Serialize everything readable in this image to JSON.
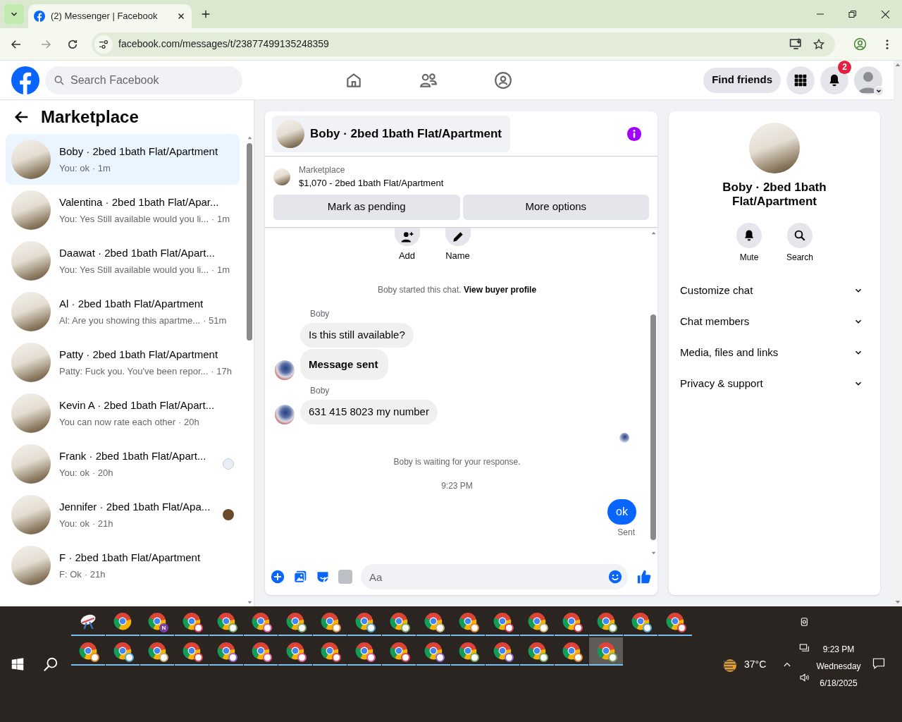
{
  "browser": {
    "tab_title": "(2) Messenger | Facebook",
    "url": "facebook.com/messages/t/23877499135248359"
  },
  "header": {
    "search_placeholder": "Search Facebook",
    "find_friends": "Find friends",
    "notification_count": "2"
  },
  "sidebar": {
    "title": "Marketplace",
    "conversations": [
      {
        "name": "Boby · 2bed 1bath Flat/Apartment",
        "preview": "You: ok",
        "time": "· 1m",
        "selected": true,
        "kind": "plain"
      },
      {
        "name": "Valentina · 2bed 1bath Flat/Apar...",
        "preview": "You: Yes Still available would you li...",
        "time": "· 1m",
        "selected": false,
        "kind": "plain"
      },
      {
        "name": "Daawat · 2bed 1bath Flat/Apart...",
        "preview": "You: Yes Still available would you li...",
        "time": "· 1m",
        "selected": false,
        "kind": "plain"
      },
      {
        "name": "Al · 2bed 1bath Flat/Apartment",
        "preview": "Al: Are you showing this apartme...",
        "time": "· 51m",
        "selected": false,
        "kind": "plain"
      },
      {
        "name": "Patty · 2bed 1bath Flat/Apartment",
        "preview": "Patty: Fuck you. You've been repor...",
        "time": "· 17h",
        "selected": false,
        "kind": "plain"
      },
      {
        "name": "Kevin A · 2bed 1bath Flat/Apart...",
        "preview": "You can now rate each other",
        "time": "· 20h",
        "selected": false,
        "kind": "plain"
      },
      {
        "name": "Frank · 2bed 1bath Flat/Apart...",
        "preview": "You: ok",
        "time": "· 20h",
        "selected": false,
        "kind": "seen-icon"
      },
      {
        "name": "Jennifer · 2bed 1bath Flat/Apa...",
        "preview": "You: ok",
        "time": "· 21h",
        "selected": false,
        "kind": "seen-photo"
      },
      {
        "name": "F · 2bed 1bath Flat/Apartment",
        "preview": "F: Ok",
        "time": "· 21h",
        "selected": false,
        "kind": "plain"
      }
    ]
  },
  "chat": {
    "title": "Boby · 2bed 1bath Flat/Apartment",
    "listing_label": "Marketplace",
    "listing": "$1,070 - 2bed 1bath Flat/Apartment",
    "buttons": [
      "Mark as pending",
      "More options"
    ],
    "actions": [
      {
        "kind": "add",
        "label": "Add"
      },
      {
        "kind": "name",
        "label": "Name"
      }
    ],
    "messages": [
      {
        "kind": "system",
        "text": "Boby started this chat. ",
        "link": "View buyer profile"
      },
      {
        "kind": "sender",
        "text": "Boby"
      },
      {
        "kind": "incoming",
        "text": "Is this still available?",
        "avatar": false,
        "bold": false
      },
      {
        "kind": "incoming",
        "text": "Message sent",
        "avatar": true,
        "bold": true
      },
      {
        "kind": "sender",
        "text": "Boby"
      },
      {
        "kind": "incoming",
        "text": "631 415 8023 my number",
        "avatar": true,
        "bold": false
      },
      {
        "kind": "seen"
      },
      {
        "kind": "notice",
        "text": "Boby is waiting for your response."
      },
      {
        "kind": "timestamp",
        "text": "9:23 PM"
      },
      {
        "kind": "outgoing",
        "text": "ok",
        "status": "Sent"
      }
    ],
    "composer_placeholder": "Aa"
  },
  "details": {
    "title": "Boby · 2bed 1bath Flat/Apartment",
    "actions": [
      {
        "kind": "mute",
        "label": "Mute"
      },
      {
        "kind": "search",
        "label": "Search"
      }
    ],
    "sections": [
      {
        "label": "Customize chat",
        "expanded": false
      },
      {
        "label": "Chat members",
        "expanded": false
      },
      {
        "label": "Media, files and links",
        "expanded": false
      },
      {
        "label": "Privacy & support",
        "expanded": false
      }
    ]
  },
  "taskbar": {
    "apps": [
      {
        "kind": "snip",
        "selected": false
      },
      {
        "kind": "chrome",
        "selected": false
      },
      {
        "kind": "badge",
        "badge": "N",
        "color": "#7b3fa6",
        "selected": false
      },
      {
        "kind": "profile",
        "color": "#e0445a",
        "selected": false
      },
      {
        "kind": "profile",
        "color": "#7fae6a",
        "selected": false
      },
      {
        "kind": "profile",
        "color": "#e85a9a",
        "selected": false
      },
      {
        "kind": "profile",
        "color": "#7fae6a",
        "selected": false
      },
      {
        "kind": "profile",
        "color": "#e8883a",
        "selected": false
      },
      {
        "kind": "profile",
        "color": "#5aa8d8",
        "selected": false
      },
      {
        "kind": "profile",
        "color": "#7fae6a",
        "selected": false
      },
      {
        "kind": "profile",
        "color": "#c8b070",
        "selected": false
      },
      {
        "kind": "profile",
        "color": "#e8883a",
        "selected": false
      },
      {
        "kind": "profile",
        "color": "#e0445a",
        "selected": false
      },
      {
        "kind": "profile",
        "color": "#c8b070",
        "selected": false
      },
      {
        "kind": "profile",
        "color": "#e0445a",
        "selected": false
      },
      {
        "kind": "profile",
        "color": "#7fae6a",
        "selected": false
      },
      {
        "kind": "profile",
        "color": "#5aa8d8",
        "selected": false
      },
      {
        "kind": "profile",
        "color": "#e0445a",
        "selected": false
      },
      {
        "kind": "profile",
        "color": "#e8883a",
        "selected": false
      },
      {
        "kind": "profile",
        "color": "#5aa8d8",
        "selected": false
      },
      {
        "kind": "profile",
        "color": "#c8b070",
        "selected": false
      },
      {
        "kind": "profile",
        "color": "#e0445a",
        "selected": false
      },
      {
        "kind": "profile",
        "color": "#9a6ad8",
        "selected": false
      },
      {
        "kind": "profile",
        "color": "#e85a9a",
        "selected": false
      },
      {
        "kind": "profile",
        "color": "#e85a9a",
        "selected": false
      },
      {
        "kind": "profile",
        "color": "#e0445a",
        "selected": false
      },
      {
        "kind": "profile",
        "color": "#e85a9a",
        "selected": false
      },
      {
        "kind": "profile",
        "color": "#e0445a",
        "selected": false
      },
      {
        "kind": "profile",
        "color": "#9a6ad8",
        "selected": false
      },
      {
        "kind": "profile",
        "color": "#7fae6a",
        "selected": false
      },
      {
        "kind": "profile",
        "color": "#9a6ad8",
        "selected": false
      },
      {
        "kind": "profile",
        "color": "#7fae6a",
        "selected": false
      },
      {
        "kind": "profile",
        "color": "#e8883a",
        "selected": false
      },
      {
        "kind": "profile",
        "color": "#7fae6a",
        "selected": true
      }
    ],
    "temperature": "37°C",
    "time": "9:23 PM",
    "day": "Wednesday",
    "date": "6/18/2025"
  }
}
